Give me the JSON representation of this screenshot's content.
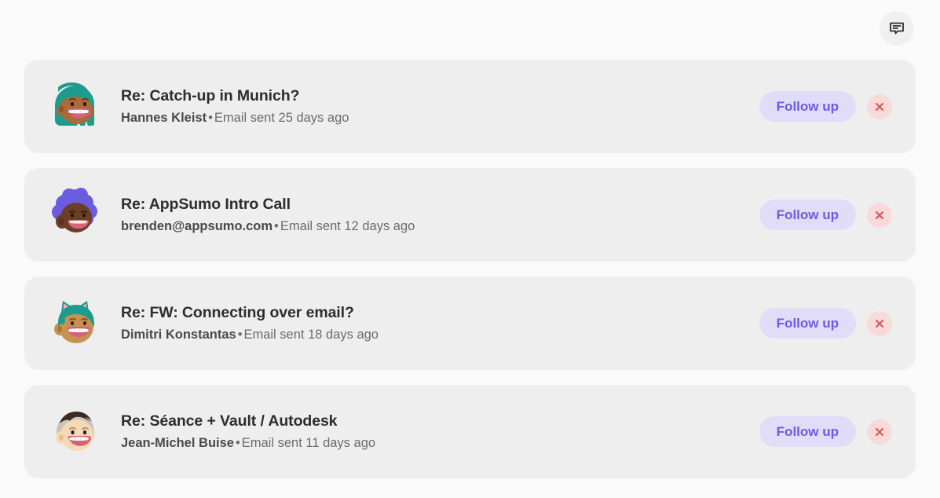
{
  "topbar": {
    "chat_button": {
      "icon": "chat-bubble-icon",
      "label": ""
    }
  },
  "theme": {
    "page_background": "#fafafa",
    "card_background": "#eeeeee",
    "follow_up_bg": "#e1ddf9",
    "follow_up_text": "#6a5bed",
    "dismiss_bg": "#f8dada",
    "dismiss_icon": "#e05252",
    "subject_color": "#2d2d2d",
    "meta_color": "#6b6b6b"
  },
  "actions": {
    "follow_up_label": "Follow up",
    "dismiss_icon": "close-icon"
  },
  "threads": [
    {
      "subject": "Re: Catch-up in Munich?",
      "who": "Hannes Kleist",
      "separator": "•",
      "when": "Email sent 25 days ago",
      "avatar": {
        "name": "avatar-hannes-kleist",
        "hair": "#1f9b8e",
        "skin": "#a96a3c",
        "skin_shadow": "#8e5730",
        "mouth": "#d2627a",
        "teeth": "#ffffff",
        "style": "long-teal-hair"
      }
    },
    {
      "subject": "Re: AppSumo Intro Call",
      "who": "brenden@appsumo.com",
      "separator": "•",
      "when": "Email sent 12 days ago",
      "avatar": {
        "name": "avatar-brenden-appsumo",
        "hair": "#6a5de0",
        "skin": "#6b3f26",
        "skin_shadow": "#57321d",
        "mouth": "#d9637d",
        "teeth": "#f4ece0",
        "style": "purple-afro"
      }
    },
    {
      "subject": "Re: FW: Connecting over email?",
      "who": "Dimitri Konstantas",
      "separator": "•",
      "when": "Email sent 18 days ago",
      "avatar": {
        "name": "avatar-dimitri-konstantas",
        "hair": "#1f9b8e",
        "skin": "#c79152",
        "skin_shadow": "#a9762f",
        "mouth": "#d2627a",
        "teeth": "#ffffff",
        "style": "teal-cat-ears"
      }
    },
    {
      "subject": "Re: Séance + Vault / Autodesk",
      "who": "Jean-Michel Buise",
      "separator": "•",
      "when": "Email sent 11 days ago",
      "avatar": {
        "name": "avatar-jean-michel-buise",
        "hair": "#3b2a22",
        "hair_grey": "#c9c4bd",
        "skin": "#f7d9b5",
        "skin_shadow": "#e8bf93",
        "mouth": "#d2627a",
        "teeth": "#ffffff",
        "style": "grey-sides-dark-top"
      }
    }
  ]
}
